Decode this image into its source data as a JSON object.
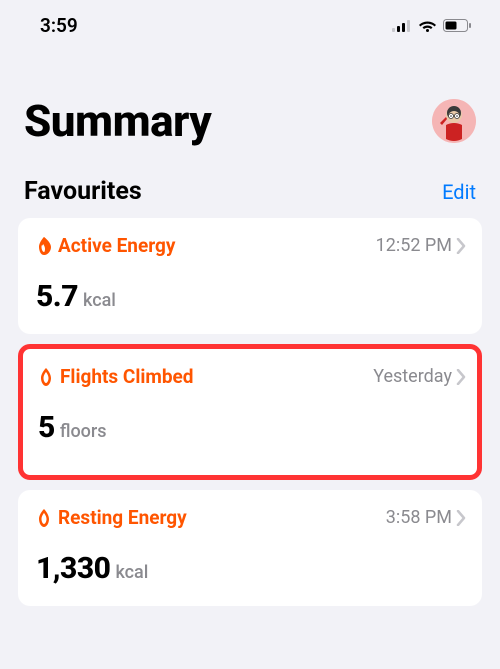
{
  "status_bar": {
    "time": "3:59"
  },
  "header": {
    "title": "Summary"
  },
  "section": {
    "title": "Favourites",
    "edit_label": "Edit"
  },
  "cards": [
    {
      "title": "Active Energy",
      "time": "12:52 PM",
      "value": "5.7",
      "unit": "kcal",
      "highlighted": false
    },
    {
      "title": "Flights Climbed",
      "time": "Yesterday",
      "value": "5",
      "unit": "floors",
      "highlighted": true
    },
    {
      "title": "Resting Energy",
      "time": "3:58 PM",
      "value": "1,330",
      "unit": "kcal",
      "highlighted": false
    }
  ]
}
